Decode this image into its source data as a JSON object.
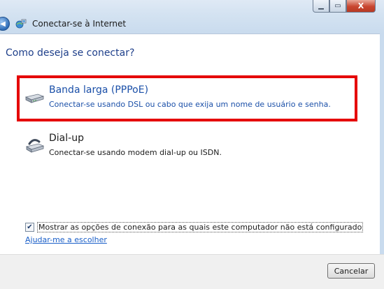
{
  "window": {
    "title": "Conectar-se à Internet",
    "controls": {
      "minimize_icon": "minimize-icon",
      "maximize_icon": "maximize-icon",
      "close_icon": "close-icon"
    },
    "close_glyph": "X"
  },
  "main": {
    "heading": "Como deseja se conectar?",
    "options": [
      {
        "title": "Banda larga (PPPoE)",
        "description": "Conectar-se usando DSL ou cabo que exija um nome de usuário e senha.",
        "icon": "broadband-modem-icon",
        "highlighted": true
      },
      {
        "title": "Dial-up",
        "description": "Conectar-se usando modem dial-up ou ISDN.",
        "icon": "dialup-modem-icon",
        "highlighted": false
      }
    ],
    "show_all_checkbox": {
      "label": "Mostrar as opções de conexão para as quais este computador não está configurado",
      "checked": true
    },
    "help_link": "Ajudar-me a escolher"
  },
  "footer": {
    "cancel_label": "Cancelar"
  },
  "colors": {
    "highlight_border": "#e50000",
    "link": "#1a4fa8"
  }
}
